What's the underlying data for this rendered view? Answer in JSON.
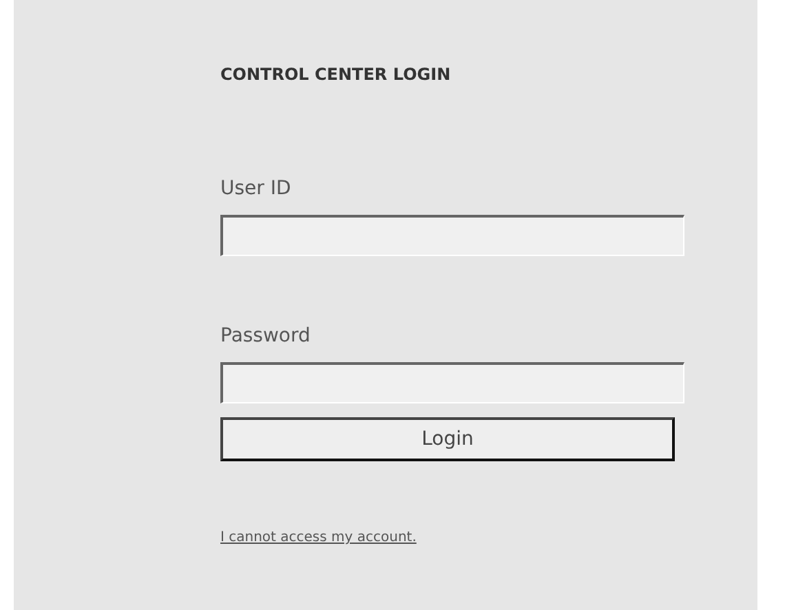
{
  "title": "CONTROL CENTER LOGIN",
  "fields": [
    {
      "label": "User ID"
    },
    {
      "label": "Password"
    }
  ],
  "button": "Login",
  "link": "I cannot access my account."
}
